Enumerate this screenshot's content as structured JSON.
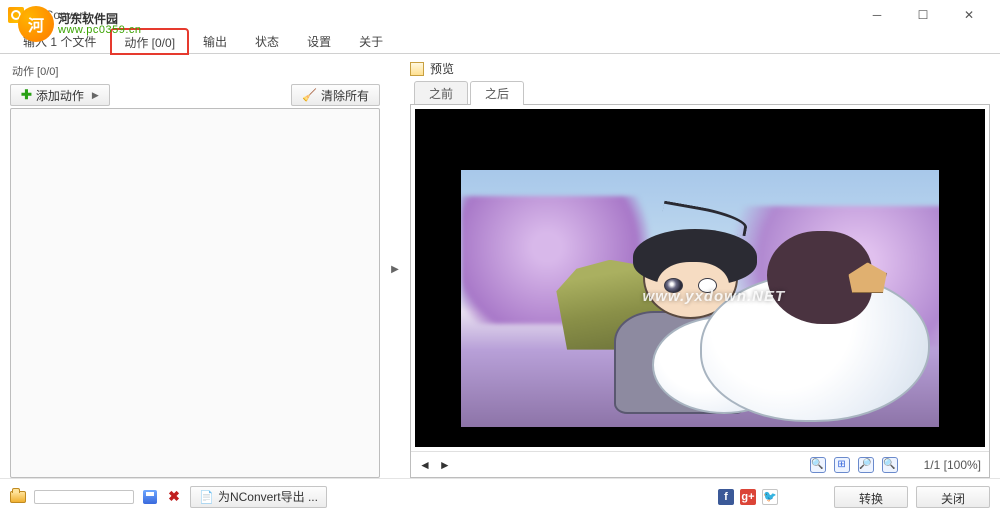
{
  "window": {
    "title": "XnConvert"
  },
  "watermark": {
    "text": "河东软件园",
    "url": "www.pc0359.cn",
    "preview_wm": "www.yxdown.NET"
  },
  "tabs": {
    "items": [
      {
        "label": "输入 1 个文件"
      },
      {
        "label": "动作 [0/0]"
      },
      {
        "label": "输出"
      },
      {
        "label": "状态"
      },
      {
        "label": "设置"
      },
      {
        "label": "关于"
      }
    ]
  },
  "left": {
    "header": "动作 [0/0]",
    "add_action": "添加动作",
    "clear_all": "清除所有"
  },
  "preview": {
    "title": "预览",
    "tab_before": "之前",
    "tab_after": "之后",
    "page_info": "1/1 [100%]"
  },
  "status": {
    "export_label": "为NConvert导出 ...",
    "convert": "转换",
    "close": "关闭"
  }
}
